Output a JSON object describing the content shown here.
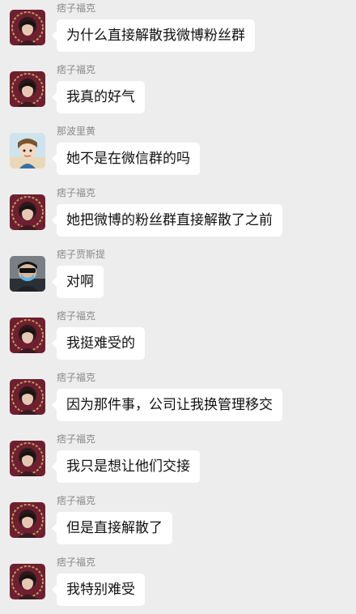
{
  "messages": [
    {
      "sender": "痞子福克",
      "text": "为什么直接解散我微博粉丝群",
      "avatar": "fuke"
    },
    {
      "sender": "痞子福克",
      "text": "我真的好气",
      "avatar": "fuke"
    },
    {
      "sender": "那波里黄",
      "text": "她不是在微信群的吗",
      "avatar": "cartoon"
    },
    {
      "sender": "痞子福克",
      "text": "她把微博的粉丝群直接解散了之前",
      "avatar": "fuke"
    },
    {
      "sender": "痞子贾斯提",
      "text": "对啊",
      "avatar": "masked"
    },
    {
      "sender": "痞子福克",
      "text": "我挺难受的",
      "avatar": "fuke"
    },
    {
      "sender": "痞子福克",
      "text": "因为那件事，公司让我换管理移交",
      "avatar": "fuke"
    },
    {
      "sender": "痞子福克",
      "text": "我只是想让他们交接",
      "avatar": "fuke"
    },
    {
      "sender": "痞子福克",
      "text": "但是直接解散了",
      "avatar": "fuke"
    },
    {
      "sender": "痞子福克",
      "text": "我特别难受",
      "avatar": "fuke"
    }
  ]
}
